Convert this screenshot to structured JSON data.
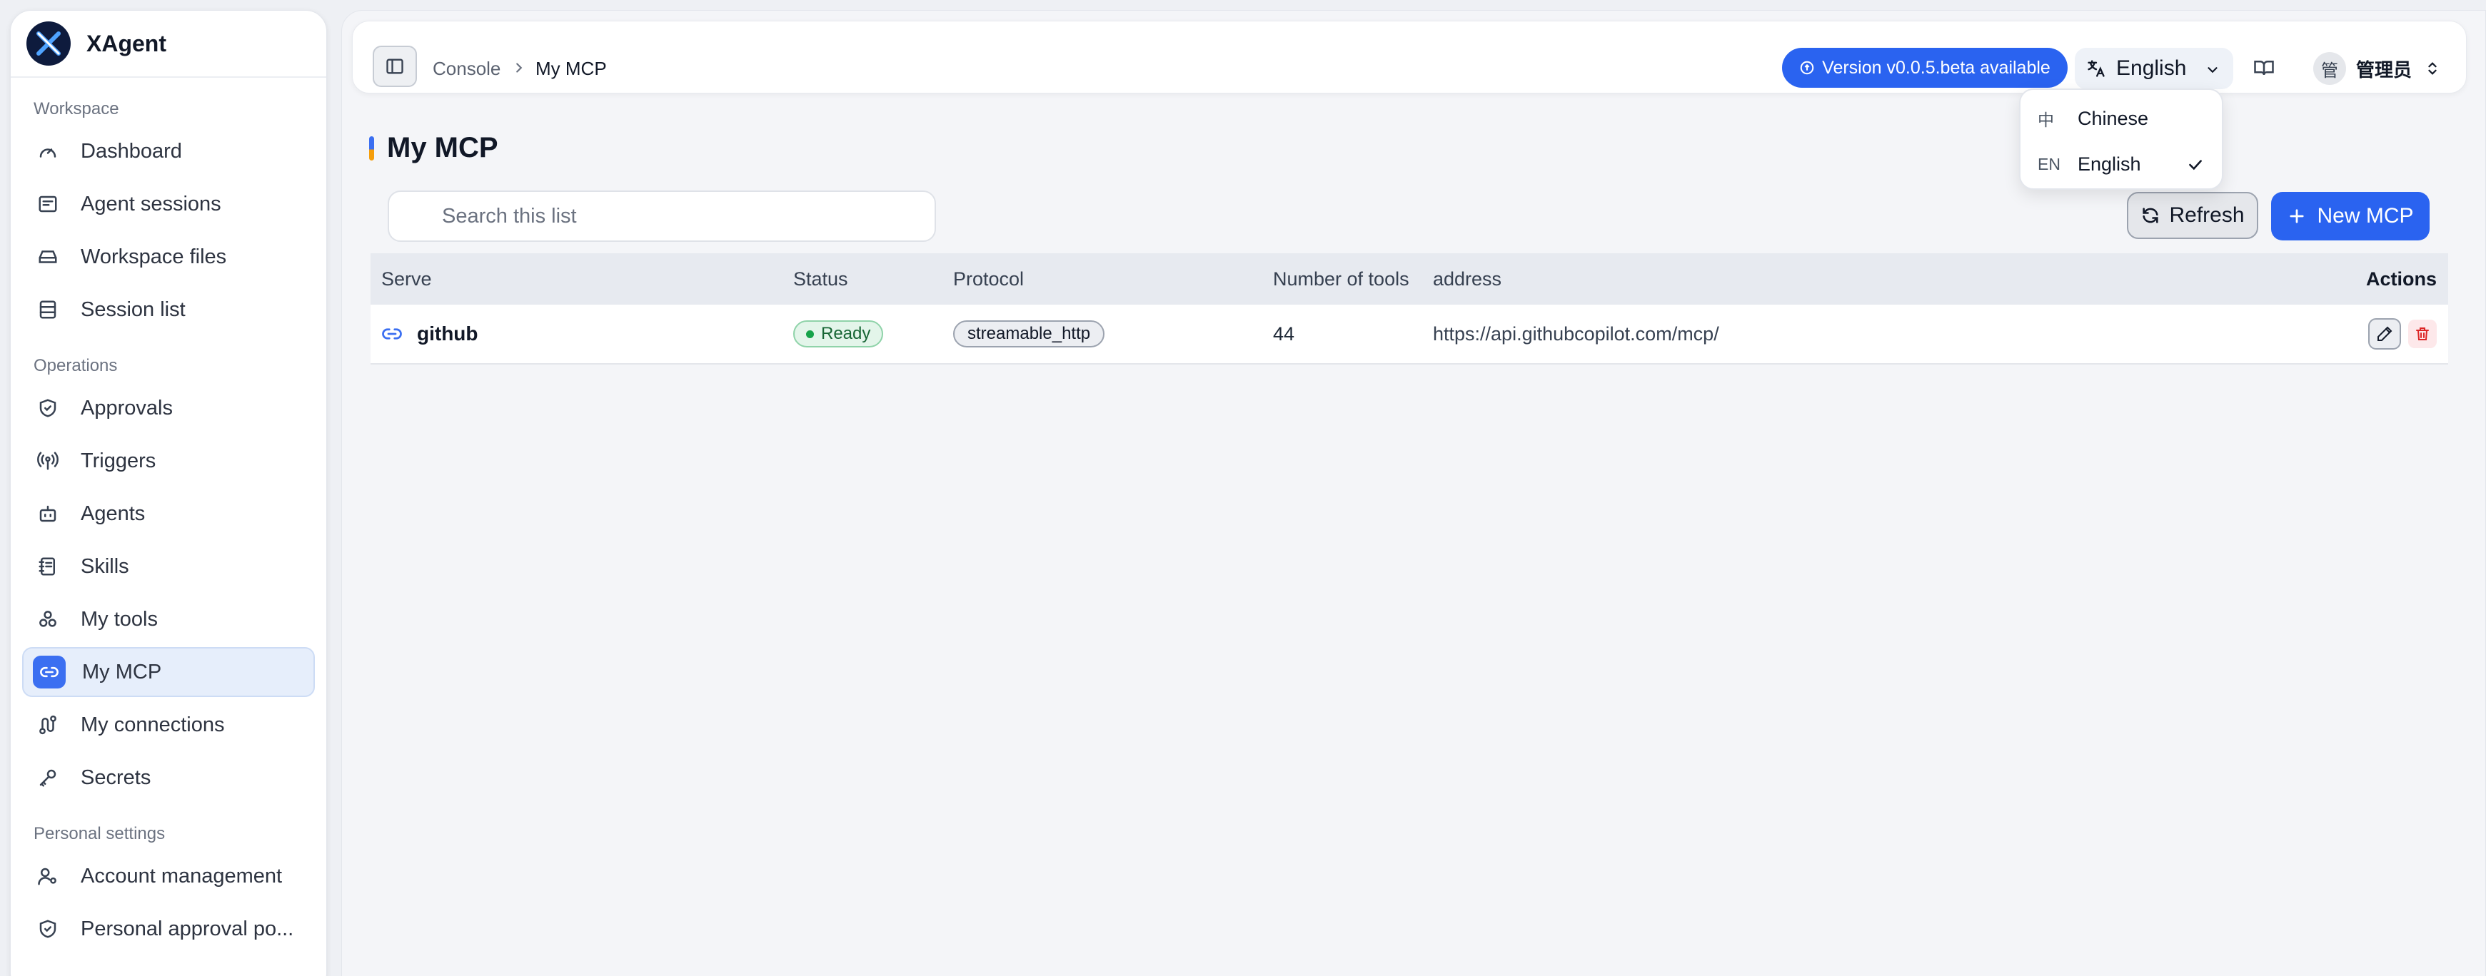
{
  "brand": {
    "name": "XAgent"
  },
  "sidebar": {
    "sections": [
      {
        "label": "Workspace",
        "items": [
          {
            "label": "Dashboard",
            "icon": "gauge-icon"
          },
          {
            "label": "Agent sessions",
            "icon": "message-square-icon"
          },
          {
            "label": "Workspace files",
            "icon": "hard-drive-icon"
          },
          {
            "label": "Session list",
            "icon": "list-icon"
          }
        ]
      },
      {
        "label": "Operations",
        "items": [
          {
            "label": "Approvals",
            "icon": "shield-check-icon"
          },
          {
            "label": "Triggers",
            "icon": "broadcast-icon"
          },
          {
            "label": "Agents",
            "icon": "bot-icon"
          },
          {
            "label": "Skills",
            "icon": "notebook-icon"
          },
          {
            "label": "My tools",
            "icon": "boxes-icon"
          },
          {
            "label": "My MCP",
            "icon": "link-icon",
            "active": true
          },
          {
            "label": "My connections",
            "icon": "route-icon"
          },
          {
            "label": "Secrets",
            "icon": "key-icon"
          }
        ]
      },
      {
        "label": "Personal settings",
        "items": [
          {
            "label": "Account management",
            "icon": "user-cog-icon"
          },
          {
            "label": "Personal approval po...",
            "icon": "shield-check-icon"
          }
        ]
      }
    ]
  },
  "breadcrumb": {
    "root": "Console",
    "current": "My MCP"
  },
  "header": {
    "version_label": "Version v0.0.5.beta available",
    "language": "English",
    "avatar_initial": "管",
    "user_name": "管理员"
  },
  "language_menu": {
    "options": [
      {
        "code": "中",
        "label": "Chinese",
        "selected": false
      },
      {
        "code": "EN",
        "label": "English",
        "selected": true
      }
    ]
  },
  "page": {
    "title": "My MCP",
    "search_placeholder": "Search this list",
    "refresh_label": "Refresh",
    "new_label": "New MCP"
  },
  "table": {
    "columns": {
      "serve": "Serve",
      "status": "Status",
      "protocol": "Protocol",
      "tools": "Number of tools",
      "address": "address",
      "actions": "Actions"
    },
    "rows": [
      {
        "serve": "github",
        "status": "Ready",
        "protocol": "streamable_http",
        "tools": "44",
        "address": "https://api.githubcopilot.com/mcp/"
      }
    ]
  },
  "colors": {
    "accent": "#2a63f0",
    "status_ready": "#16a34a",
    "delete": "#dc2626"
  }
}
